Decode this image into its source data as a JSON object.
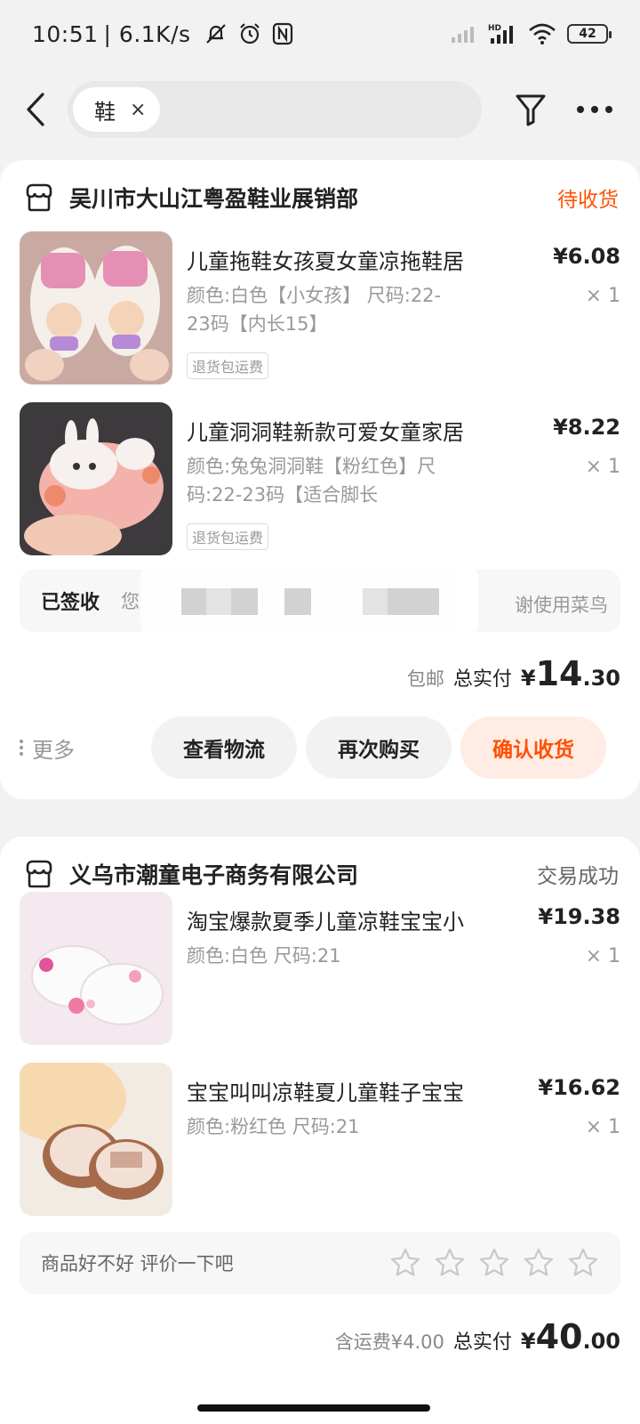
{
  "status_bar": {
    "time": "10:51",
    "speed": "| 6.1K/s",
    "battery": "42"
  },
  "search": {
    "keyword": "鞋",
    "clear_glyph": "×"
  },
  "orders": [
    {
      "shop": "吴川市大山江粤盈鞋业展销部",
      "status": "待收货",
      "status_color": "#ff5000",
      "items": [
        {
          "title": "儿童拖鞋女孩夏女童凉拖鞋居",
          "spec": "颜色:白色【小女孩】 尺码:22-23码【内长15】",
          "badge": "退货包运费",
          "price_yen": "¥",
          "price_int": "6",
          "price_dec": ".08",
          "qty": "× 1"
        },
        {
          "title": "儿童洞洞鞋新款可爱女童家居",
          "spec": "颜色:兔兔洞洞鞋【粉红色】尺码:22-23码【适合脚长",
          "badge": "退货包运费",
          "price_yen": "¥",
          "price_int": "8",
          "price_dec": ".22",
          "qty": "× 1"
        }
      ],
      "tracking": {
        "status": "已签收",
        "text_start": "您",
        "text_end": "谢使用菜鸟"
      },
      "shipping_note": "包邮",
      "total_label": "总实付",
      "total_yen": "¥",
      "total_int": "14",
      "total_dec": ".30",
      "actions": {
        "more": "更多",
        "view_logistics": "查看物流",
        "buy_again": "再次购买",
        "confirm_receipt": "确认收货"
      }
    },
    {
      "shop": "义乌市潮童电子商务有限公司",
      "status": "交易成功",
      "items": [
        {
          "title": "淘宝爆款夏季儿童凉鞋宝宝小",
          "spec": "颜色:白色 尺码:21",
          "price_yen": "¥",
          "price_int": "19",
          "price_dec": ".38",
          "qty": "× 1"
        },
        {
          "title": "宝宝叫叫凉鞋夏儿童鞋子宝宝",
          "spec": "颜色:粉红色 尺码:21",
          "price_yen": "¥",
          "price_int": "16",
          "price_dec": ".62",
          "qty": "× 1"
        }
      ],
      "review_prompt": "商品好不好 评价一下吧",
      "shipping_note": "含运费¥4.00",
      "total_label": "总实付",
      "total_yen": "¥",
      "total_int": "40",
      "total_dec": ".00"
    }
  ],
  "colors": {
    "accent": "#ff5000",
    "accent_bg": "#ffece4",
    "page_bg": "#f2f2f2"
  }
}
